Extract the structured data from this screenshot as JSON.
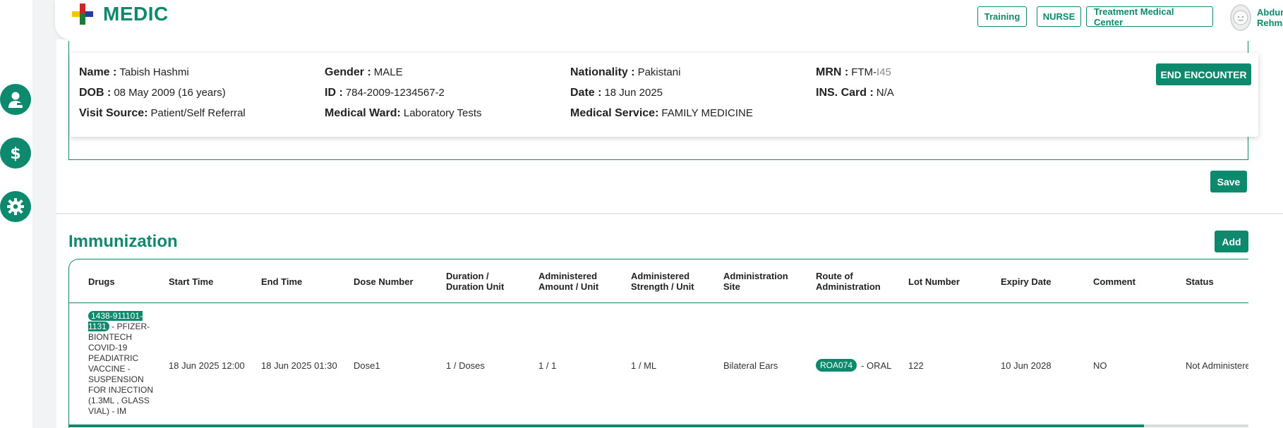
{
  "header": {
    "app_name": "MEDIC",
    "buttons": [
      "Training",
      "NURSE",
      "Treatment Medical Center"
    ],
    "user_name": "Abdur Rehman"
  },
  "sidebar": {
    "icons": [
      "doctor-icon",
      "dollar-icon",
      "gear-icon"
    ]
  },
  "patient": {
    "name_label": "Name :",
    "name": "Tabish Hashmi",
    "gender_label": "Gender :",
    "gender": "MALE",
    "nationality_label": "Nationality :",
    "nationality": "Pakistani",
    "mrn_label": "MRN :",
    "mrn_prefix": "FTM-",
    "mrn_suffix": "I45",
    "dob_label": "DOB :",
    "dob": "08 May 2009 (16 years)",
    "id_label": "ID :",
    "id": "784-2009-1234567-2",
    "date_label": "Date :",
    "date": "18 Jun 2025",
    "ins_label": "INS. Card :",
    "ins": "N/A",
    "visit_label": "Visit Source:",
    "visit": "Patient/Self Referral",
    "ward_label": "Medical Ward:",
    "ward": "Laboratory Tests",
    "service_label": "Medical Service:",
    "service": "FAMILY MEDICINE"
  },
  "actions": {
    "end_encounter": "END ENCOUNTER",
    "save": "Save",
    "add": "Add"
  },
  "immunization": {
    "title": "Immunization",
    "columns": [
      "Drugs",
      "Start Time",
      "End Time",
      "Dose Number",
      "Duration / Duration Unit",
      "Administered Amount / Unit",
      "Administered Strength / Unit",
      "Administration Site",
      "Route of Administration",
      "Lot Number",
      "Expiry Date",
      "Comment",
      "Status"
    ],
    "rows": [
      {
        "drug_code": "1438-911101-1131",
        "drug_name": " - PFIZER-BIONTECH COVID-19 PEADIATRIC VACCINE - SUSPENSION FOR INJECTION (1.3ML , GLASS VIAL) - IM",
        "start_time": "18 Jun 2025 12:00",
        "end_time": "18 Jun 2025 01:30",
        "dose_number": "Dose1",
        "duration": "1 / Doses",
        "amount": "1 / 1",
        "strength": "1 / ML",
        "site": "Bilateral Ears",
        "route_code": "ROA074",
        "route_name": " - ORAL",
        "lot": "122",
        "expiry": "10 Jun 2028",
        "comment": "NO",
        "status": "Not Administered"
      }
    ]
  },
  "colors": {
    "primary": "#0d8a6d"
  }
}
